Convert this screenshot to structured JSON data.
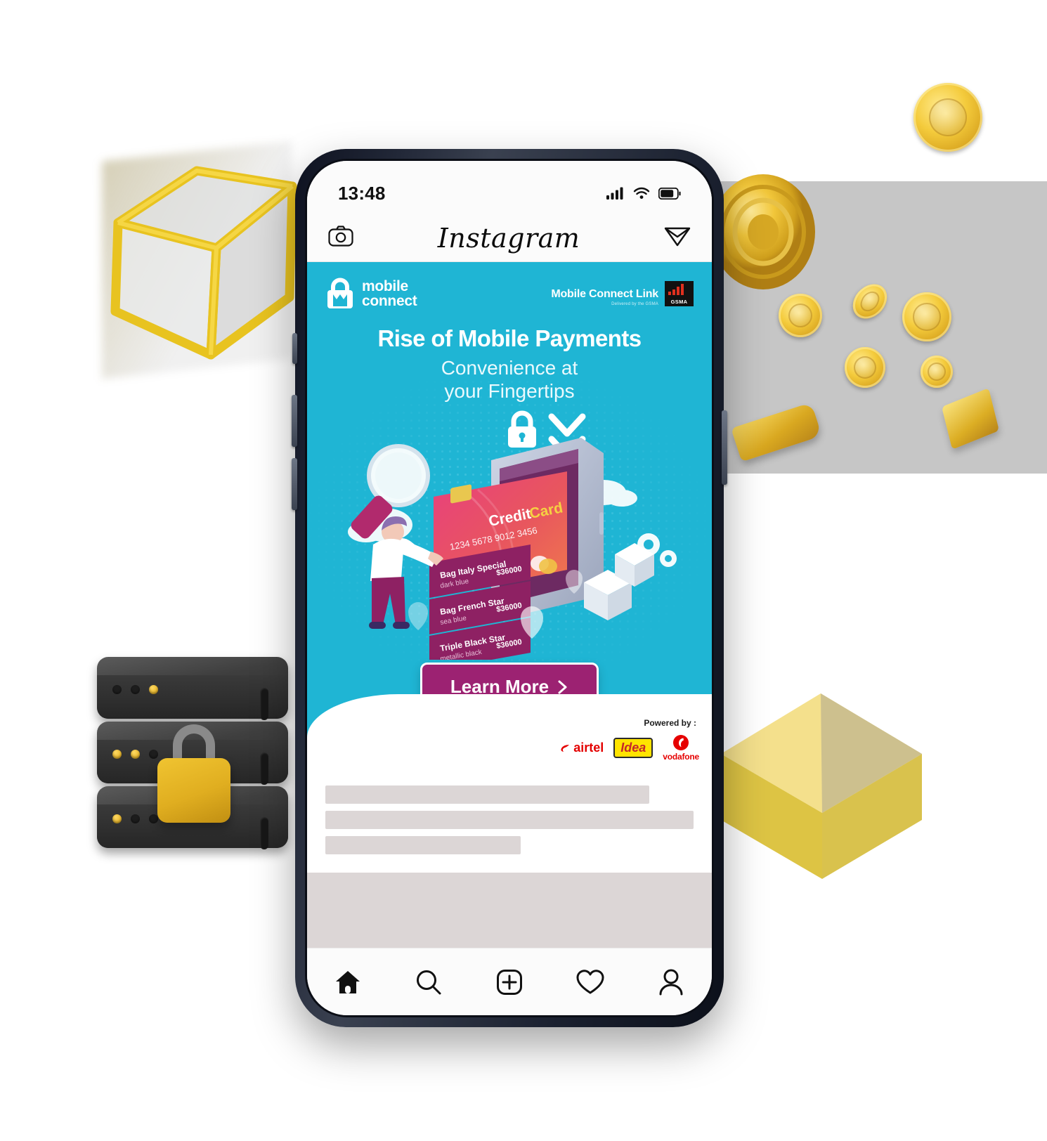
{
  "scene": {
    "description": "Instagram ad post on a smartphone surrounded by 3D fintech props",
    "props": [
      {
        "name": "glass-cube",
        "label": "gold wireframe glass cube"
      },
      {
        "name": "gold-medallion",
        "label": "gold medallion"
      },
      {
        "name": "gold-coins",
        "label": "scattered gold coins"
      },
      {
        "name": "gold-bars",
        "label": "gold bars"
      },
      {
        "name": "server-stack",
        "label": "server stack"
      },
      {
        "name": "padlock",
        "label": "yellow padlock"
      },
      {
        "name": "gold-cube",
        "label": "solid gold cube"
      }
    ]
  },
  "phone": {
    "status_bar": {
      "time": "13:48",
      "icons": [
        "cellular-signal-icon",
        "wifi-icon",
        "battery-icon"
      ],
      "battery_level": 70
    },
    "buttons": [
      "mute-switch",
      "volume-up-button",
      "volume-down-button",
      "power-button"
    ]
  },
  "instagram": {
    "header": {
      "camera_icon": "camera-icon",
      "wordmark": "Instagram",
      "direct_icon": "paper-plane-icon"
    },
    "nav": [
      {
        "name": "home",
        "icon": "home-icon",
        "active": true
      },
      {
        "name": "search",
        "icon": "search-icon",
        "active": false
      },
      {
        "name": "create",
        "icon": "plus-square-icon",
        "active": false
      },
      {
        "name": "activity",
        "icon": "heart-icon",
        "active": false
      },
      {
        "name": "profile",
        "icon": "person-icon",
        "active": false
      }
    ],
    "caption_skeleton": {
      "line_widths": [
        "88%",
        "100%",
        "53%"
      ]
    }
  },
  "ad": {
    "brand": {
      "logo_mark": "mobile-connect-lock-icon",
      "logo_line1": "mobile",
      "logo_line2": "connect",
      "partner_title": "Mobile Connect Link",
      "partner_subtitle": "Delivered by the GSMA",
      "gsma_label": "GSMA"
    },
    "headline": "Rise of Mobile Payments",
    "subheadline_line1": "Convenience at",
    "subheadline_line2": "your Fingertips",
    "illustration": {
      "lock_icon": "padlock-icon",
      "chevrons_icon": "double-chevron-down-icon",
      "magnifier_icon": "magnifying-glass-icon",
      "gears_icon": "gears-icon",
      "cloud_icon": "cloud-icon",
      "pin_icon": "map-pin-icon",
      "card": {
        "brand_text": "CreditCard",
        "number": "1234  5678  9012  3456",
        "chip_label": "chip-icon"
      },
      "list_items": [
        {
          "title": "Bag Italy Special",
          "subtitle": "dark blue",
          "price": "$36000"
        },
        {
          "title": "Bag French Star",
          "subtitle": "sea blue",
          "price": "$36000"
        },
        {
          "title": "Triple Black Star",
          "subtitle": "metallic black",
          "price": "$36000"
        }
      ]
    },
    "cta": {
      "label": "Learn More",
      "chevron": "chevron-right-icon"
    },
    "footer": {
      "powered_by": "Powered by :",
      "carriers": [
        {
          "name": "airtel",
          "label": "airtel"
        },
        {
          "name": "idea",
          "label": "Idea"
        },
        {
          "name": "vodafone",
          "label": "vodafone"
        }
      ]
    },
    "colors": {
      "bg_cyan": "#1fb5d4",
      "cta_magenta": "#9c2272",
      "card_magenta": "#8e2163",
      "gsma_red": "#e0301e",
      "airtel_red": "#e40000",
      "idea_yellow": "#ffe400",
      "vodafone_red": "#e60000",
      "gold": "#e0ae20"
    }
  }
}
